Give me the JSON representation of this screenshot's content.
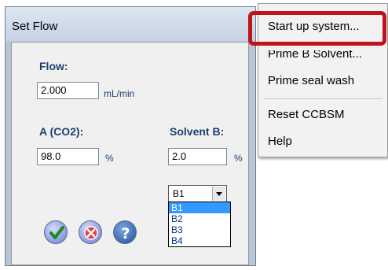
{
  "dialog": {
    "title": "Set Flow",
    "flow": {
      "label": "Flow:",
      "value": "2.000",
      "unit": "mL/min"
    },
    "a_co2": {
      "label": "A (CO2):",
      "value": "98.0",
      "unit": "%"
    },
    "solvent_b": {
      "label": "Solvent B:",
      "value": "2.0",
      "unit": "%",
      "selected": "B1",
      "options": [
        "B1",
        "B2",
        "B3",
        "B4"
      ]
    },
    "buttons": [
      "ok-check-icon",
      "cancel-x-icon",
      "help-question-icon"
    ]
  },
  "menu": {
    "items": [
      "Start up system...",
      "Prime B Solvent...",
      "Prime seal wash",
      "Reset CCBSM",
      "Help"
    ],
    "highlight_color": "#c0141c"
  }
}
